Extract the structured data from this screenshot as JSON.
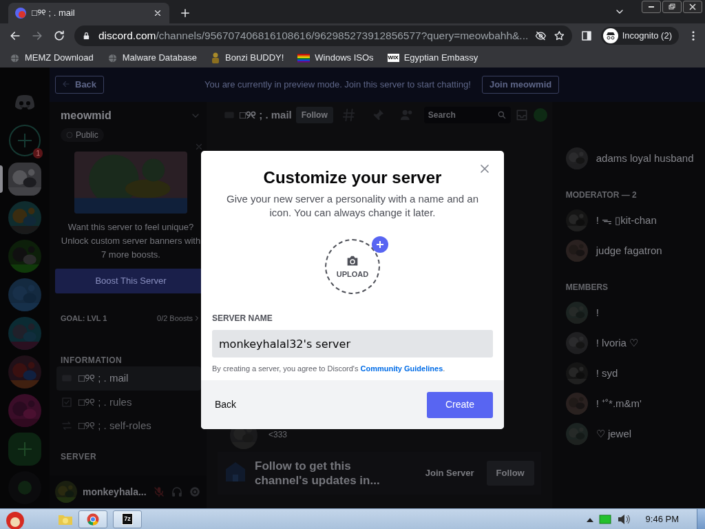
{
  "browser": {
    "tabs": [
      {
        "title": "□୨୧ ;  . mail",
        "selected": true
      }
    ],
    "address": {
      "host": "discord.com",
      "path": "/channels/956707406816108616/962985273912856577?query=meowbahh&..."
    },
    "profile": "Incognito (2)",
    "bookmarks": [
      {
        "label": "MEMZ Download",
        "kind": "globe"
      },
      {
        "label": "Malware Database",
        "kind": "globe"
      },
      {
        "label": "Bonzi BUDDY!",
        "kind": "figure"
      },
      {
        "label": "Windows ISOs",
        "kind": "rainbow"
      },
      {
        "label": "Egyptian Embassy",
        "kind": "wix",
        "badge": "WIX"
      }
    ]
  },
  "preview_bar": {
    "back": "Back",
    "notice": "You are currently in preview mode. Join this server to start chatting!",
    "join": "Join meowmid"
  },
  "servers": [
    {
      "kind": "home",
      "selected": false
    },
    {
      "kind": "add",
      "selected": false,
      "badge": "1"
    },
    {
      "kind": "server",
      "selected": true
    },
    {
      "kind": "server",
      "selected": false
    },
    {
      "kind": "server",
      "selected": false
    },
    {
      "kind": "server",
      "selected": false
    },
    {
      "kind": "server",
      "selected": false
    },
    {
      "kind": "server",
      "selected": false
    },
    {
      "kind": "server",
      "selected": false
    },
    {
      "kind": "create",
      "selected": false
    },
    {
      "kind": "explore",
      "selected": false
    }
  ],
  "sidebar": {
    "server_name": "meowmid",
    "visibility": "Public",
    "boost": {
      "text": "Want this server to feel unique? Unlock custom server banners with 7 more boosts.",
      "button": "Boost This Server"
    },
    "goal": {
      "label": "GOAL: LVL 1",
      "progress": "0/2 Boosts"
    },
    "categories": [
      {
        "name": "INFORMATION",
        "channels": [
          {
            "name": "□୨୧ ; . mail",
            "kind": "text",
            "selected": true
          },
          {
            "name": "□୨୧ ; . rules",
            "kind": "rules",
            "selected": false
          },
          {
            "name": "□୨୧ ; . self-roles",
            "kind": "roles",
            "selected": false
          }
        ]
      },
      {
        "name": "SERVER"
      }
    ],
    "user": {
      "name": "monkeyhala..."
    }
  },
  "channel": {
    "name": "□୨୧ ; . mail",
    "follow": "Follow",
    "search_placeholder": "Search",
    "message": "<333",
    "follow_bar": {
      "text": "Follow to get this channel's updates in...",
      "join": "Join Server",
      "follow": "Follow"
    }
  },
  "members": [
    {
      "members": [
        {
          "name": "adams loyal husband"
        }
      ]
    },
    {
      "title": "MODERATOR — 2",
      "members": [
        {
          "name": "! ᯓ ▯kit-chan"
        },
        {
          "name": "judge fagatron"
        }
      ]
    },
    {
      "title": "MEMBERS",
      "members": [
        {
          "name": "!"
        },
        {
          "name": "! lvoria ♡"
        },
        {
          "name": "! syd"
        },
        {
          "name": "! ⁺˚*.m&m'"
        },
        {
          "name": "♡ jewel"
        }
      ]
    }
  ],
  "modal": {
    "title": "Customize your server",
    "subtitle": "Give your new server a personality with a name and an icon. You can always change it later.",
    "upload": "UPLOAD",
    "field_label": "SERVER NAME",
    "value": "monkeyhalal32's server",
    "terms": "By creating a server, you agree to Discord's ",
    "terms_link": "Community Guidelines",
    "terms_end": ".",
    "back": "Back",
    "create": "Create"
  },
  "taskbar": {
    "apps": [
      {
        "kind": "folder"
      },
      {
        "kind": "browser"
      },
      {
        "kind": "archiver",
        "label": "7z"
      }
    ],
    "clock": "9:46 PM"
  }
}
